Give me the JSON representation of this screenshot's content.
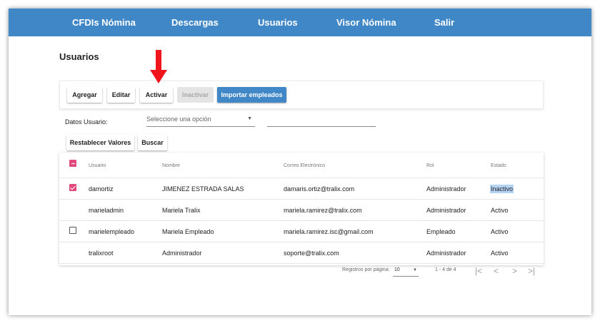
{
  "nav": {
    "items": [
      "CFDIs Nómina",
      "Descargas",
      "Usuarios",
      "Visor Nómina",
      "Salir"
    ]
  },
  "page": {
    "title": "Usuarios"
  },
  "toolbar": {
    "agregar": "Agregar",
    "editar": "Editar",
    "activar": "Activar",
    "inactivar": "Inactivar",
    "importar": "Importar empleados"
  },
  "filter": {
    "label": "Datos Usuario:",
    "select_placeholder": "Seleccione una opción",
    "reset": "Restablecer Valores",
    "search": "Buscar"
  },
  "table": {
    "headers": {
      "usuario": "Usuario",
      "nombre": "Nombre",
      "correo": "Correo Electrónico",
      "rol": "Rol",
      "estado": "Estado"
    },
    "rows": [
      {
        "usuario": "damortiz",
        "nombre": "JIMENEZ ESTRADA SALAS",
        "correo": "damaris.ortiz@tralix.com",
        "rol": "Administrador",
        "estado": "Inactivo",
        "checkbox": "checked"
      },
      {
        "usuario": "marieladmin",
        "nombre": "Mariela Tralix",
        "correo": "mariela.ramirez@tralix.com",
        "rol": "Administrador",
        "estado": "Activo",
        "checkbox": "none"
      },
      {
        "usuario": "marielempleado",
        "nombre": "Mariela Empleado",
        "correo": "mariela.ramirez.isc@gmail.com",
        "rol": "Empleado",
        "estado": "Activo",
        "checkbox": "unchecked"
      },
      {
        "usuario": "tralixroot",
        "nombre": "Administrador",
        "correo": "soporte@tralix.com",
        "rol": "Administrador",
        "estado": "Activo",
        "checkbox": "none"
      }
    ]
  },
  "pagination": {
    "per_page_label": "Registros por página:",
    "per_page_value": "10",
    "range": "1 - 4 de 4",
    "first": "|<",
    "prev": "<",
    "next": ">",
    "last": ">|"
  },
  "colors": {
    "brand": "#3f87c6",
    "arrow": "#f0141c",
    "checkbox": "#e0497b",
    "highlight": "#b5d3f5"
  },
  "icons": {
    "arrow": "red-down-arrow-icon",
    "caret": "caret-down-icon"
  }
}
